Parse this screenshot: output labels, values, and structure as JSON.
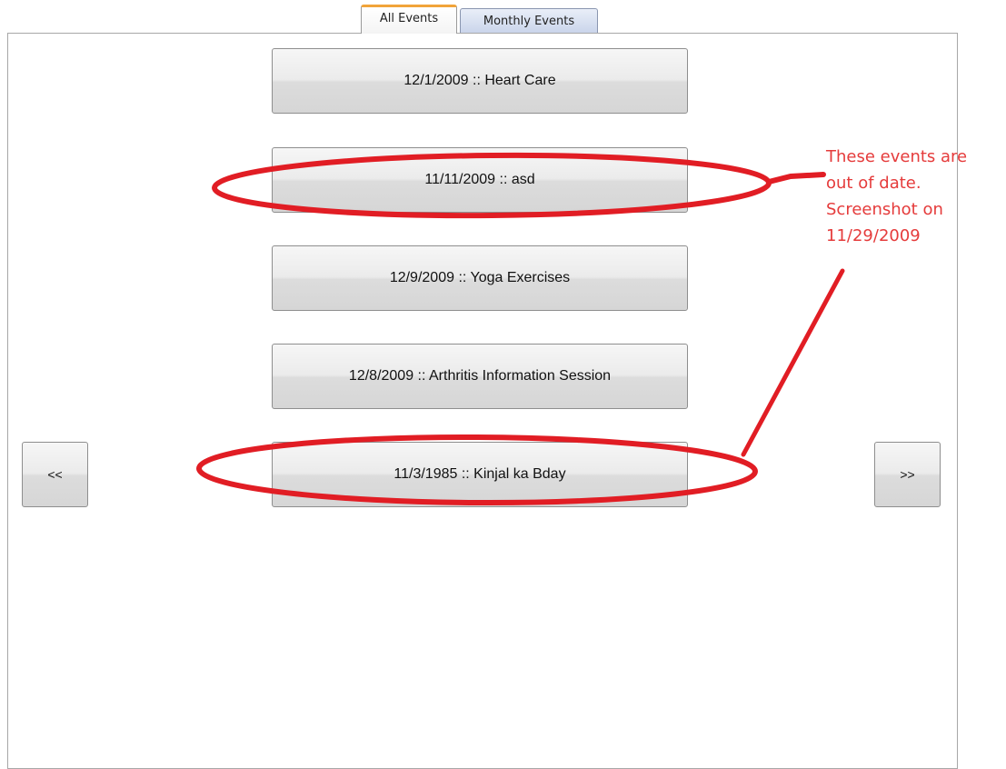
{
  "tabs": {
    "all_events": "All Events",
    "monthly_events": "Monthly Events",
    "active": "All Events"
  },
  "events": [
    "12/1/2009 :: Heart Care",
    "11/11/2009 :: asd",
    "12/9/2009 :: Yoga Exercises",
    "12/8/2009 :: Arthritis Information Session",
    "11/3/1985 :: Kinjal ka Bday"
  ],
  "nav": {
    "prev_label": "<<",
    "next_label": ">>"
  },
  "annotation": {
    "lines": [
      "These events are",
      "out of date.",
      "Screenshot on",
      "11/29/2009"
    ],
    "color": "#e53b3b"
  }
}
